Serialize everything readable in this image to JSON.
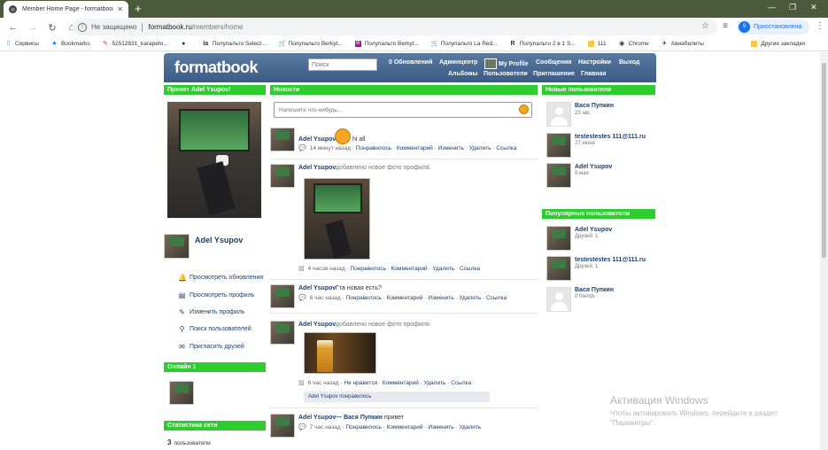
{
  "browser": {
    "tab_title": "Member Home Page - formatbook",
    "url_insecure": "Не защищено",
    "url_host": "formatbook.ru",
    "url_path": "/members/home",
    "profile_label": "Приостановлена",
    "profile_initial": "9"
  },
  "bookmarks": [
    {
      "label": "Сервисы",
      "icon": "apps-icon"
    },
    {
      "label": "Bookmarks",
      "icon": "star-icon"
    },
    {
      "label": "52512831_karapeto...",
      "icon": "bookmark-icon"
    },
    {
      "label": "",
      "icon": "bookmark-icon"
    },
    {
      "label": "Полупальто Select...",
      "icon": "bookmark-icon"
    },
    {
      "label": "Полупальто Berkyt...",
      "icon": "cart-icon"
    },
    {
      "label": "Полупальто Berkyt...",
      "icon": "bookmark-icon"
    },
    {
      "label": "Полупальто La Red...",
      "icon": "cart-icon"
    },
    {
      "label": "Полупальто 2 в 1 S...",
      "icon": "bookmark-icon"
    },
    {
      "label": "111",
      "icon": "folder-icon"
    },
    {
      "label": "Chrome",
      "icon": "chrome-icon"
    },
    {
      "label": "Авиабилеты",
      "icon": "plane-icon"
    }
  ],
  "bookmarks_other": "Другие закладки",
  "header": {
    "logo": "formatbook",
    "search_placeholder": "Поиск",
    "updates": "0 Обновлений",
    "admin": "Админцентр",
    "my_profile": "My Profile",
    "messages": "Сообщения",
    "settings": "Настройки",
    "logout": "Выход",
    "albums": "Альбомы",
    "users": "Пользователи",
    "invite": "Приглашение",
    "home": "Главная"
  },
  "left": {
    "greeting": "Привет Adel Ysupov!",
    "username": "Adel Ysupov",
    "menu": [
      {
        "label": "Просмотреть обновления",
        "icon": "bell-icon"
      },
      {
        "label": "Просмотреть профиль",
        "icon": "profile-card-icon"
      },
      {
        "label": "Изменить профиль",
        "icon": "pencil-icon"
      },
      {
        "label": "Поиск пользователей",
        "icon": "search-icon"
      },
      {
        "label": "Пригласить друзей",
        "icon": "envelope-icon"
      }
    ],
    "online_title": "Онлайн 1",
    "stats_title": "Статистика сети",
    "stats_count": "3",
    "stats_label": "пользователи"
  },
  "center": {
    "title": "Новости",
    "status_placeholder": "Напишите что-нибудь...",
    "posts": [
      {
        "name": "Adel Ysupov",
        "text": "hi all",
        "time": "14 минут назад",
        "like": "Понравилось",
        "comment": "Комментарий",
        "edit": "Изменить",
        "delete": "Удалить",
        "link": "Ссылка"
      },
      {
        "name": "Adel Ysupov",
        "text": "добавлено новое фото профиля.",
        "time": "4 часов назад",
        "like": "Понравилось",
        "comment": "Комментарий",
        "delete": "Удалить",
        "link": "Ссылка"
      },
      {
        "name": "Adel Ysupov",
        "text": "Гта новая есть?",
        "time": "6 час назад",
        "like": "Понравилось",
        "comment": "Комментарий",
        "edit": "Изменить",
        "delete": "Удалить",
        "link": "Ссылка"
      },
      {
        "name": "Adel Ysupov",
        "text": "добавлено новое фото профиля.",
        "time": "6 час назад",
        "like": "Не нравится",
        "comment": "Комментарий",
        "delete": "Удалить",
        "link": "Ссылка",
        "liked_by": "Adel Ysupov понравилось"
      },
      {
        "name": "Adel Ysupov",
        "arrow": "— Вася Пупкин",
        "text": ": привет",
        "time": "7 час назад",
        "like": "Понравилось",
        "comment": "Комментарий",
        "edit": "Изменить",
        "delete": "Удалить"
      }
    ]
  },
  "right": {
    "new_title": "Новые пользователи",
    "new_users": [
      {
        "name": "Вася Пупкин",
        "sub": "23 авг."
      },
      {
        "name": "testestestes 111@111.ru",
        "sub": "27 июня"
      },
      {
        "name": "Adel Ysupov",
        "sub": "9 мая"
      }
    ],
    "popular_title": "Популярные пользователи",
    "popular_users": [
      {
        "name": "Adel Ysupov",
        "sub": "Друзей: 1"
      },
      {
        "name": "testestestes 111@111.ru",
        "sub": "Друзей: 1"
      },
      {
        "name": "Вася Пупкин",
        "sub": "0 friends"
      }
    ]
  },
  "watermark": {
    "title": "Активация Windows",
    "text": "Чтобы активировать Windows, перейдите в раздел \"Параметры\"."
  }
}
